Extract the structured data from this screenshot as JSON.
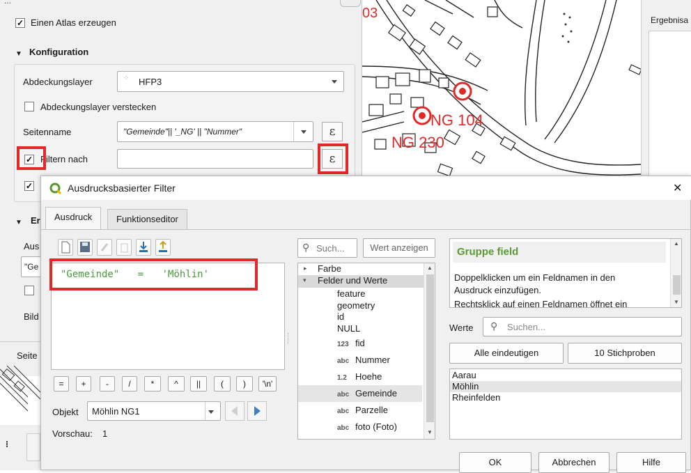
{
  "atlas": {
    "header_partial": "...",
    "generate_atlas_label": "Einen Atlas erzeugen",
    "config_title": "Konfiguration",
    "coverage_layer_label": "Abdeckungslayer",
    "coverage_layer_value": "HFP3",
    "hide_coverage_label": "Abdeckungslayer verstecken",
    "page_name_label": "Seitenname",
    "page_name_value": "\"Gemeinde\"|| '_NG' || \"Nummer\"",
    "filter_label": "Filtern nach",
    "epsilon": "ε",
    "section2_partial": "Er",
    "output_partial": "Aus",
    "output_value_partial": "\"Ge",
    "image_partial": "Bild",
    "page_partial": "Seite"
  },
  "map": {
    "labels": [
      "NG 104",
      "NG 230",
      "03"
    ]
  },
  "results_panel": {
    "title": "Ergebnisa"
  },
  "dialog": {
    "title": "Ausdrucksbasierter Filter",
    "close": "✕",
    "tabs": [
      "Ausdruck",
      "Funktionseditor"
    ],
    "expression": {
      "field": "\"Gemeinde\"",
      "operator": "=",
      "literal": "'Möhlin'"
    },
    "operators": [
      "=",
      "+",
      "-",
      "/",
      "*",
      "^",
      "||",
      "(",
      ")",
      "'\\n'"
    ],
    "object_label": "Objekt",
    "object_value": "Möhlin NG1",
    "preview_label": "Vorschau:",
    "preview_value": "1",
    "search_placeholder": "Such...",
    "show_values_button": "Wert anzeigen",
    "tree": {
      "group_color": "Farbe",
      "group_fields": "Felder und Werte",
      "items": [
        {
          "type": "",
          "label": "feature"
        },
        {
          "type": "",
          "label": "geometry"
        },
        {
          "type": "",
          "label": "id"
        },
        {
          "type": "",
          "label": "NULL"
        },
        {
          "type": "123",
          "label": "fid"
        },
        {
          "type": "abc",
          "label": "Nummer"
        },
        {
          "type": "1.2",
          "label": "Hoehe"
        },
        {
          "type": "abc",
          "label": "Gemeinde"
        },
        {
          "type": "abc",
          "label": "Parzelle"
        },
        {
          "type": "abc",
          "label": "foto (Foto)"
        }
      ]
    },
    "help": {
      "title": "Gruppe field",
      "line1": "Doppelklicken um ein Feldnamen in den",
      "line2": "Ausdruck einzufügen.",
      "line3": "Rechtsklick auf einen Feldnamen öffnet ein"
    },
    "values_label": "Werte",
    "values_search_placeholder": "Suchen...",
    "all_unique_button": "Alle eindeutigen",
    "samples_button": "10 Stichproben",
    "values": [
      "Aarau",
      "Möhlin",
      "Rheinfelden"
    ],
    "ok_button": "OK",
    "cancel_button": "Abbrechen",
    "help_button": "Hilfe"
  },
  "colors": {
    "highlight_frame": "#e02a2a",
    "map_label": "#e02a2a",
    "qgis_logo": "#589632",
    "help_title": "#5a9a35",
    "expression_text": "#4a9a3c"
  }
}
